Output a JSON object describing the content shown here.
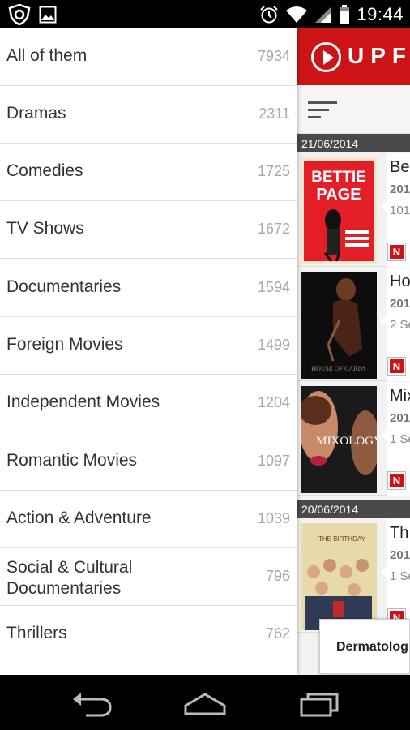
{
  "status_bar": {
    "time": "19:44",
    "left_icons": [
      "shield-icon",
      "image-icon"
    ],
    "right_icons": [
      "alarm-icon",
      "wifi-icon",
      "signal-icon",
      "battery-icon"
    ]
  },
  "app": {
    "logo_text": "UPF",
    "brand_color": "#cc1417",
    "sections": [
      {
        "date": "21/06/2014",
        "items": [
          {
            "title": "Be",
            "year": "201",
            "sub": "101",
            "badge": "N",
            "poster": "bettie-page-poster"
          },
          {
            "title": "Ho",
            "year": "201",
            "sub": "2 Se",
            "badge": "N",
            "poster": "house-of-cards-poster"
          },
          {
            "title": "Mix",
            "year": "201",
            "sub": "1 Se",
            "badge": "N",
            "poster": "mixology-poster"
          }
        ]
      },
      {
        "date": "20/06/2014",
        "items": [
          {
            "title": "Th",
            "year": "201",
            "sub": "1 Se",
            "badge": "N",
            "poster": "birthday-boys-poster"
          }
        ]
      }
    ],
    "ad_text": "Dermatolog"
  },
  "drawer": {
    "categories": [
      {
        "label": "All of them",
        "count": "7934"
      },
      {
        "label": "Dramas",
        "count": "2311"
      },
      {
        "label": "Comedies",
        "count": "1725"
      },
      {
        "label": "TV Shows",
        "count": "1672"
      },
      {
        "label": "Documentaries",
        "count": "1594"
      },
      {
        "label": "Foreign Movies",
        "count": "1499"
      },
      {
        "label": "Independent Movies",
        "count": "1204"
      },
      {
        "label": "Romantic Movies",
        "count": "1097"
      },
      {
        "label": "Action & Adventure",
        "count": "1039"
      },
      {
        "label": "Social & Cultural Documentaries",
        "count": "796"
      },
      {
        "label": "Thrillers",
        "count": "762"
      }
    ]
  },
  "nav_bar": {
    "buttons": [
      "back-icon",
      "home-icon",
      "recent-apps-icon"
    ]
  }
}
